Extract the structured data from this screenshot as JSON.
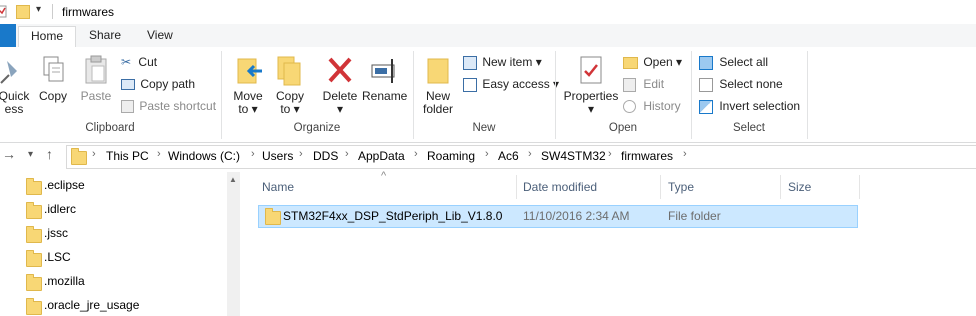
{
  "window": {
    "title": "firmwares"
  },
  "ribbon_tabs": [
    {
      "label": "Home"
    },
    {
      "label": "Share"
    },
    {
      "label": "View"
    }
  ],
  "clipboard": {
    "quick_access": "Quick\ness",
    "copy": "Copy",
    "paste": "Paste",
    "cut": "Cut",
    "copy_path": "Copy path",
    "paste_shortcut": "Paste shortcut",
    "group_label": "Clipboard"
  },
  "organize": {
    "move_to": "Move\nto ▾",
    "copy_to": "Copy\nto ▾",
    "delete": "Delete\n▾",
    "rename": "Rename",
    "group_label": "Organize"
  },
  "new": {
    "new_folder": "New\nfolder",
    "new_item": "New item ▾",
    "easy_access": "Easy access ▾",
    "group_label": "New"
  },
  "open": {
    "properties": "Properties\n▾",
    "open": "Open ▾",
    "edit": "Edit",
    "history": "History",
    "group_label": "Open"
  },
  "select": {
    "select_all": "Select all",
    "select_none": "Select none",
    "invert_selection": "Invert selection",
    "group_label": "Select"
  },
  "breadcrumb": [
    "This PC",
    "Windows (C:)",
    "Users",
    "DDS",
    "AppData",
    "Roaming",
    "Ac6",
    "SW4STM32",
    "firmwares"
  ],
  "nav_pane": [
    ".eclipse",
    ".idlerc",
    ".jssc",
    ".LSC",
    ".mozilla",
    ".oracle_jre_usage"
  ],
  "columns": {
    "name": "Name",
    "date": "Date modified",
    "type": "Type",
    "size": "Size"
  },
  "files": [
    {
      "name": "STM32F4xx_DSP_StdPeriph_Lib_V1.8.0",
      "date": "11/10/2016 2:34 AM",
      "type": "File folder",
      "size": ""
    }
  ],
  "colors": {
    "accent": "#1979ca",
    "selection": "#cce8ff",
    "folder": "#f8d775"
  }
}
